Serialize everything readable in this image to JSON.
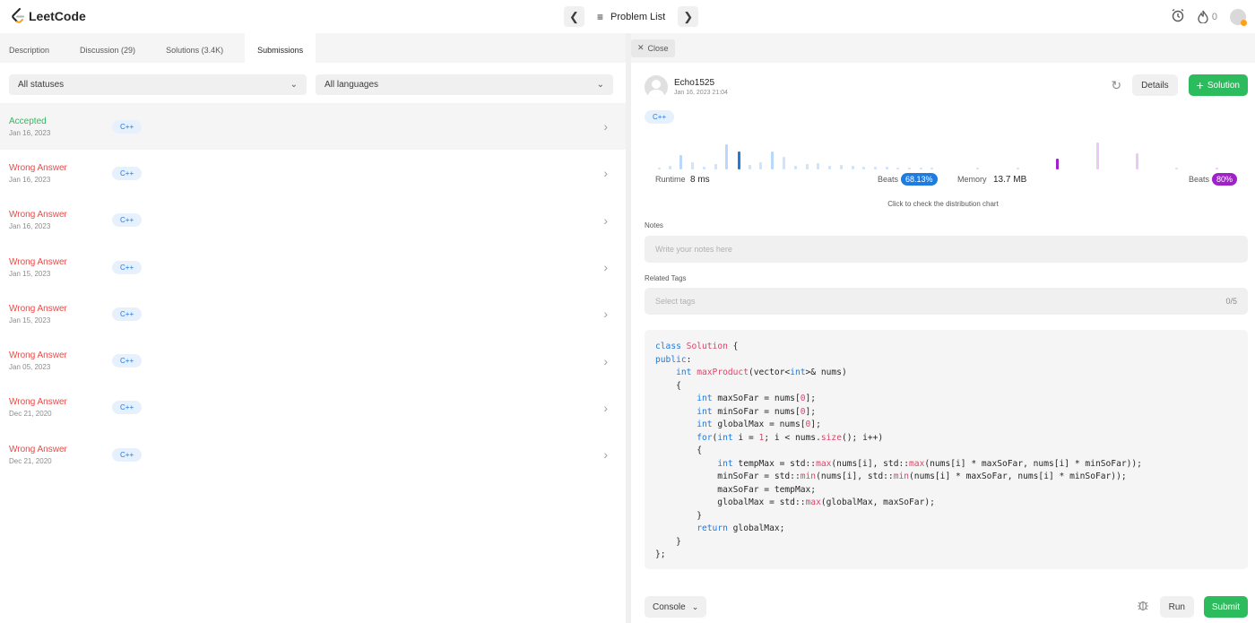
{
  "app": {
    "logo_text": "LeetCode",
    "problem_list": "Problem List",
    "fire_count": "0"
  },
  "left_tabs": [
    {
      "label": "Description"
    },
    {
      "label": "Discussion (29)"
    },
    {
      "label": "Solutions (3.4K)"
    },
    {
      "label": "Submissions"
    }
  ],
  "filters": {
    "status": "All statuses",
    "language": "All languages"
  },
  "submissions": [
    {
      "status": "Accepted",
      "date": "Jan 16, 2023",
      "lang": "C++",
      "kind": "acc"
    },
    {
      "status": "Wrong Answer",
      "date": "Jan 16, 2023",
      "lang": "C++",
      "kind": "wa"
    },
    {
      "status": "Wrong Answer",
      "date": "Jan 16, 2023",
      "lang": "C++",
      "kind": "wa"
    },
    {
      "status": "Wrong Answer",
      "date": "Jan 15, 2023",
      "lang": "C++",
      "kind": "wa"
    },
    {
      "status": "Wrong Answer",
      "date": "Jan 15, 2023",
      "lang": "C++",
      "kind": "wa"
    },
    {
      "status": "Wrong Answer",
      "date": "Jan 05, 2023",
      "lang": "C++",
      "kind": "wa"
    },
    {
      "status": "Wrong Answer",
      "date": "Dec 21, 2020",
      "lang": "C++",
      "kind": "wa"
    },
    {
      "status": "Wrong Answer",
      "date": "Dec 21, 2020",
      "lang": "C++",
      "kind": "wa"
    }
  ],
  "detail": {
    "close_label": "Close",
    "username": "Echo1525",
    "date": "Jan 16, 2023 21:04",
    "details_label": "Details",
    "solution_label": "Solution",
    "lang": "C++",
    "runtime_label": "Runtime",
    "runtime_value": "8 ms",
    "runtime_beats_label": "Beats",
    "runtime_beats": "68.13%",
    "memory_label": "Memory",
    "memory_value": "13.7 MB",
    "memory_beats_label": "Beats",
    "memory_beats": "80%",
    "dist_note": "Click to check the distribution chart",
    "notes_label": "Notes",
    "notes_placeholder": "Write your notes here",
    "tags_label": "Related Tags",
    "tags_placeholder": "Select tags",
    "tags_count": "0/5"
  },
  "code_lines": [
    "class Solution {",
    "public:",
    "    int maxProduct(vector<int>& nums)",
    "    {",
    "        int maxSoFar = nums[0];",
    "        int minSoFar = nums[0];",
    "        int globalMax = nums[0];",
    "        for(int i = 1; i < nums.size(); i++)",
    "        {",
    "            int tempMax = std::max(nums[i], std::max(nums[i] * maxSoFar, nums[i] * minSoFar));",
    "            minSoFar = std::min(nums[i], std::min(nums[i] * maxSoFar, nums[i] * minSoFar));",
    "            maxSoFar = tempMax;",
    "            globalMax = std::max(globalMax, maxSoFar);",
    "        }",
    "        return globalMax;",
    "    }",
    "};"
  ],
  "bottom": {
    "console_label": "Console",
    "run_label": "Run",
    "submit_label": "Submit"
  },
  "colors": {
    "accent_green": "#2cbb5d",
    "wrong_red": "#ef4743",
    "runtime_blue": "#1e7be0",
    "memory_purple": "#a020c9"
  }
}
